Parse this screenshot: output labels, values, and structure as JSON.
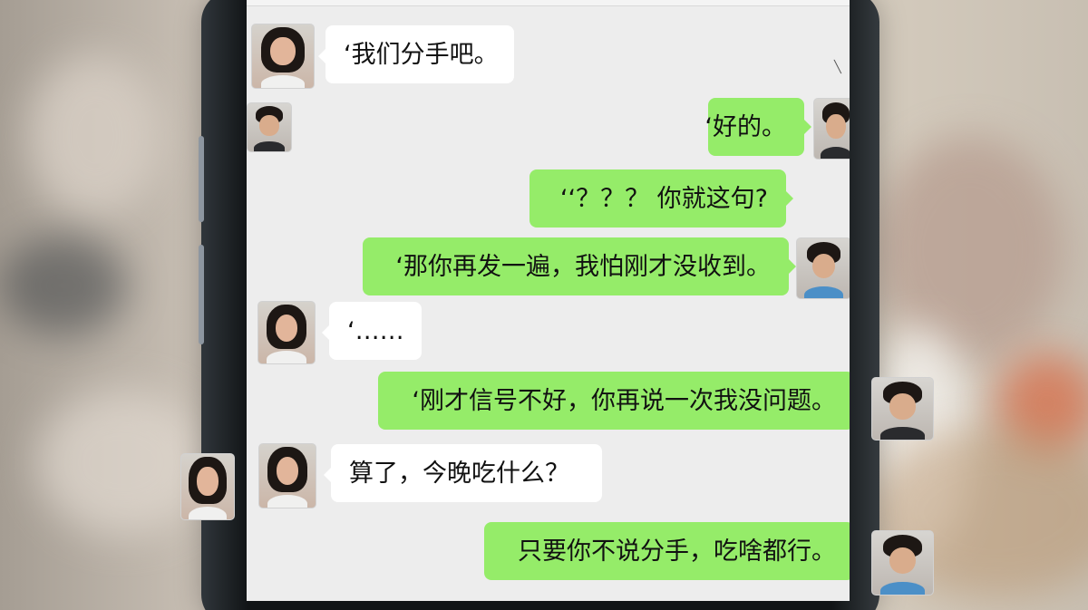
{
  "chat": {
    "messages": [
      {
        "side": "left",
        "text": "‘我们分手吧。"
      },
      {
        "side": "right",
        "text": "‘好的。"
      },
      {
        "side": "right",
        "text": "‘‘？？？ 你就这句?"
      },
      {
        "side": "right",
        "text": "‘那你再发一遍，我怕刚才没收到。"
      },
      {
        "side": "left",
        "text": "‘……"
      },
      {
        "side": "right",
        "text": "‘刚才信号不好，你再说一次我没问题。"
      },
      {
        "side": "left",
        "text": "算了，今晚吃什么？"
      },
      {
        "side": "right",
        "text": "只要你不说分手，吃啥都行。"
      }
    ]
  },
  "colors": {
    "outgoing_bubble": "#95ec69",
    "incoming_bubble": "#ffffff",
    "chat_background": "#ededed"
  }
}
